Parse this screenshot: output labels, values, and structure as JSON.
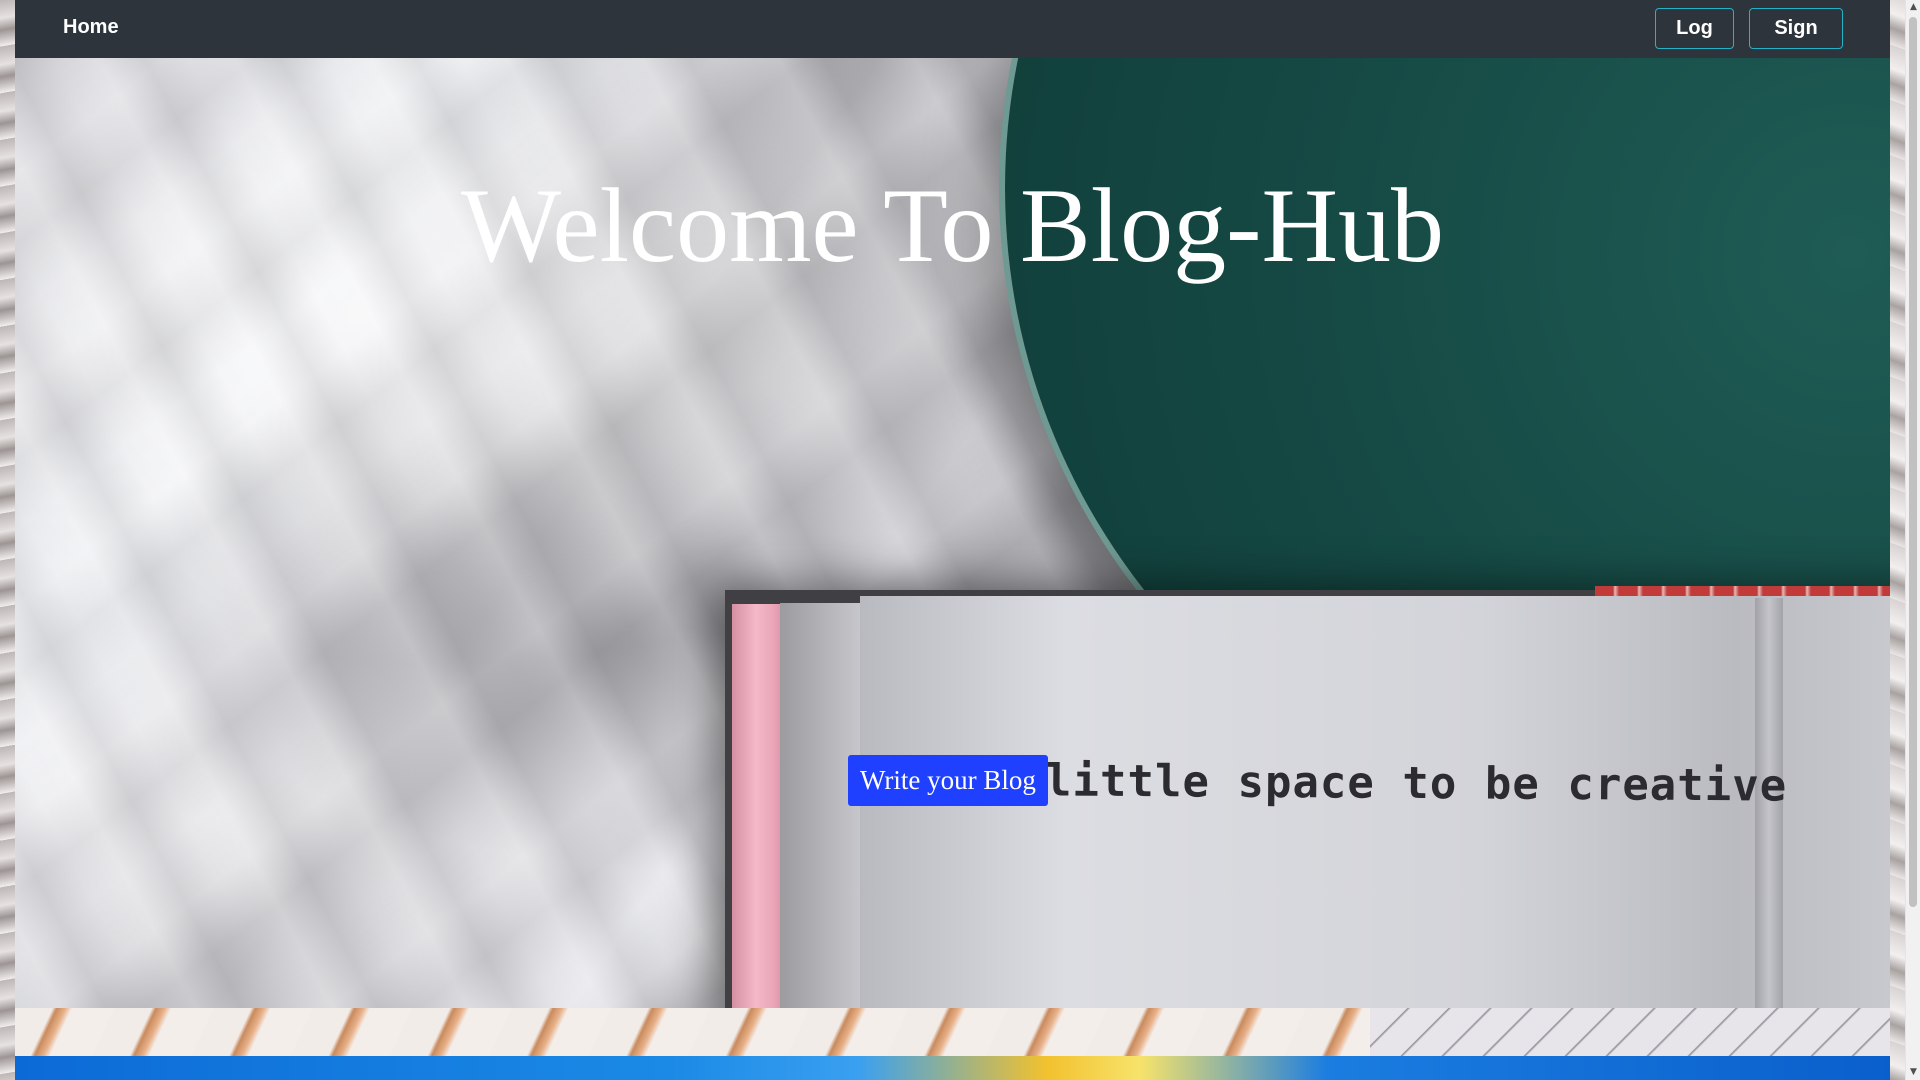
{
  "navbar": {
    "home_label": "Home",
    "login_label": "Log in",
    "signup_label": "Sign Up",
    "background_color": "#2d343b",
    "button_border_color": "#24b3c6"
  },
  "hero": {
    "title": "Welcome To Blog-Hub",
    "cta_label": "Write your Blog",
    "cta_color": "#1f40ff",
    "image_caption_text": "little space to be creative"
  },
  "scrollbar": {
    "up_icon": "▲",
    "down_icon": "▼"
  }
}
